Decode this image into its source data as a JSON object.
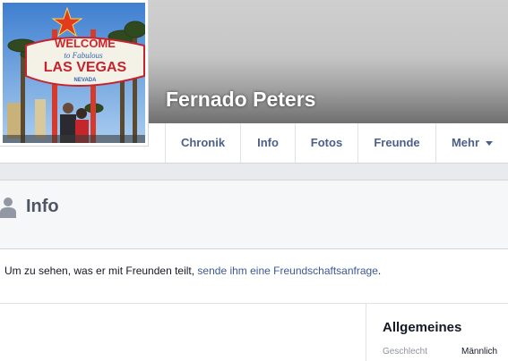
{
  "profile": {
    "name": "Fernado Peters",
    "picture_sign": {
      "welcome": "WELCOME",
      "to_fabulous": "to Fabulous",
      "city": "LAS VEGAS",
      "state": "NEVADA"
    }
  },
  "nav": {
    "tabs": [
      {
        "label": "Chronik"
      },
      {
        "label": "Info"
      },
      {
        "label": "Fotos"
      },
      {
        "label": "Freunde"
      },
      {
        "label": "Mehr"
      }
    ]
  },
  "info": {
    "title": "Info",
    "notice_prefix": "Um zu sehen, was er mit Freunden teilt, ",
    "notice_link": "sende ihm eine Freundschaftsanfrage",
    "notice_suffix": "."
  },
  "general": {
    "title": "Allgemeines",
    "rows": [
      {
        "label": "Geschlecht",
        "value": "Männlich"
      }
    ]
  },
  "colors": {
    "link": "#3b5998",
    "tab_text": "#4b5f8b",
    "background": "#e9eaed"
  },
  "icons": {
    "profile_section": "person-icon",
    "more_menu": "caret-down-icon"
  }
}
